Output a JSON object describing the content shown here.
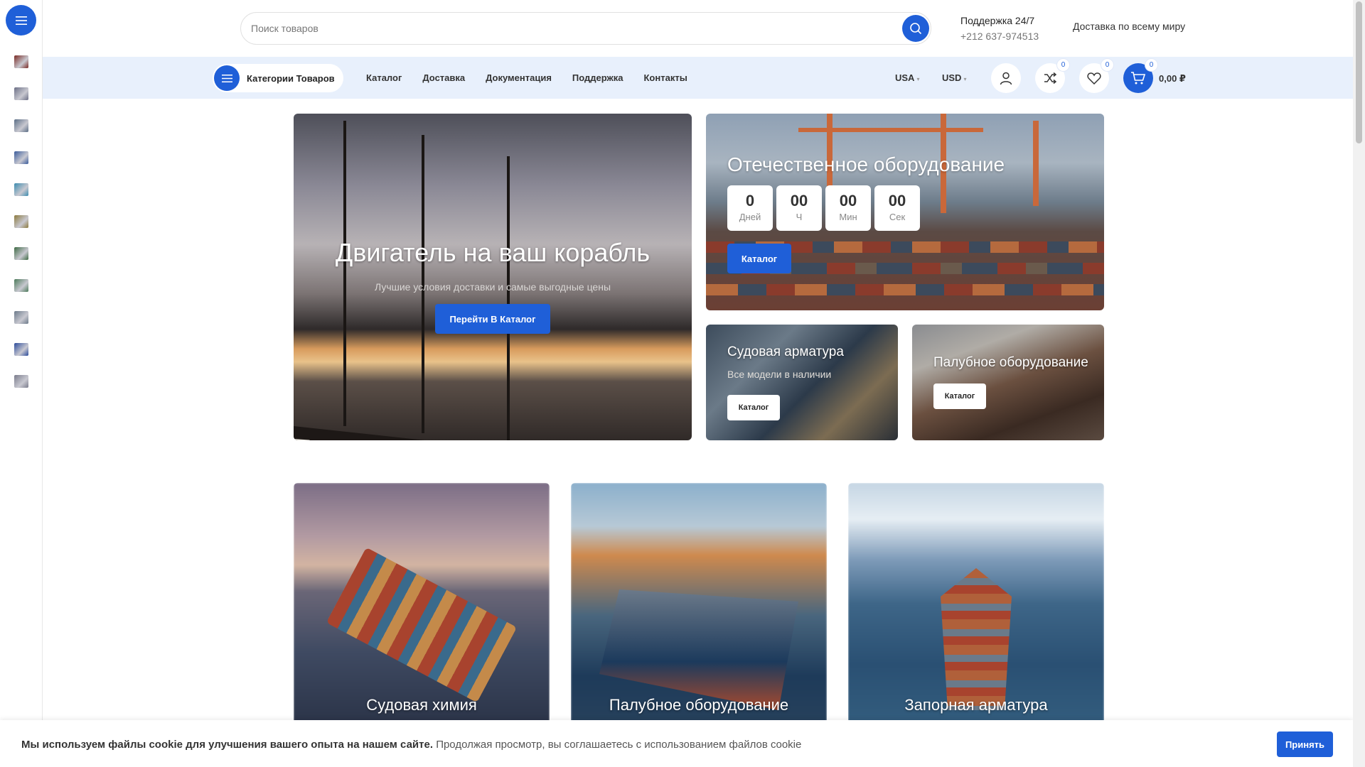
{
  "header": {
    "search_placeholder": "Поиск товаров",
    "support_title": "Поддержка 24/7",
    "support_phone": "+212 637-974513",
    "delivery": "Доставка по всему миру"
  },
  "nav": {
    "categories_label": "Категории Товаров",
    "menu": [
      "Каталог",
      "Доставка",
      "Документация",
      "Поддержка",
      "Контакты"
    ],
    "country": "USA",
    "currency": "USD",
    "compare_count": "0",
    "wishlist_count": "0",
    "cart_count": "0",
    "cart_total": "0,00 ₽"
  },
  "sidebar": {
    "items": [
      {
        "icon": "category-thumb-1",
        "color": "#7a2a24"
      },
      {
        "icon": "category-thumb-2",
        "color": "#6b6f86"
      },
      {
        "icon": "category-thumb-3",
        "color": "#5b6e86"
      },
      {
        "icon": "category-thumb-4",
        "color": "#3a5c9c"
      },
      {
        "icon": "category-thumb-5",
        "color": "#3c8cb0"
      },
      {
        "icon": "category-thumb-6",
        "color": "#8c7a3e"
      },
      {
        "icon": "category-thumb-7",
        "color": "#3e6a44"
      },
      {
        "icon": "category-thumb-8",
        "color": "#4c7a5a"
      },
      {
        "icon": "category-thumb-9",
        "color": "#6c7a8a"
      },
      {
        "icon": "category-thumb-10",
        "color": "#2c4c9c"
      },
      {
        "icon": "category-thumb-11",
        "color": "#7a7c8c"
      }
    ]
  },
  "hero": {
    "main_title": "Двигатель на ваш корабль",
    "main_subtitle": "Лучшие условия доставки и самые выгодные цены",
    "main_button": "Перейти В Каталог",
    "promo_title": "Отечественное оборудование",
    "countdown": [
      {
        "value": "0",
        "unit": "Дней"
      },
      {
        "value": "00",
        "unit": "Ч"
      },
      {
        "value": "00",
        "unit": "Мин"
      },
      {
        "value": "00",
        "unit": "Сек"
      }
    ],
    "promo_button": "Каталог",
    "valves_title": "Судовая арматура",
    "valves_subtitle": "Все модели в наличии",
    "valves_button": "Каталог",
    "deck_title": "Палубное оборудование",
    "deck_button": "Каталог"
  },
  "categories": [
    {
      "title": "Судовая химия"
    },
    {
      "title": "Палубное оборудование"
    },
    {
      "title": "Запорная арматура"
    }
  ],
  "cookie": {
    "bold_text": "Мы используем файлы cookie для улучшения вашего опыта на нашем сайте.",
    "text": "Продолжая просмотр, вы соглашаетесь с использованием файлов cookie",
    "button": "Принять"
  },
  "colors": {
    "accent": "#1f5fd8",
    "navbar_bg": "#e8f0fc"
  }
}
